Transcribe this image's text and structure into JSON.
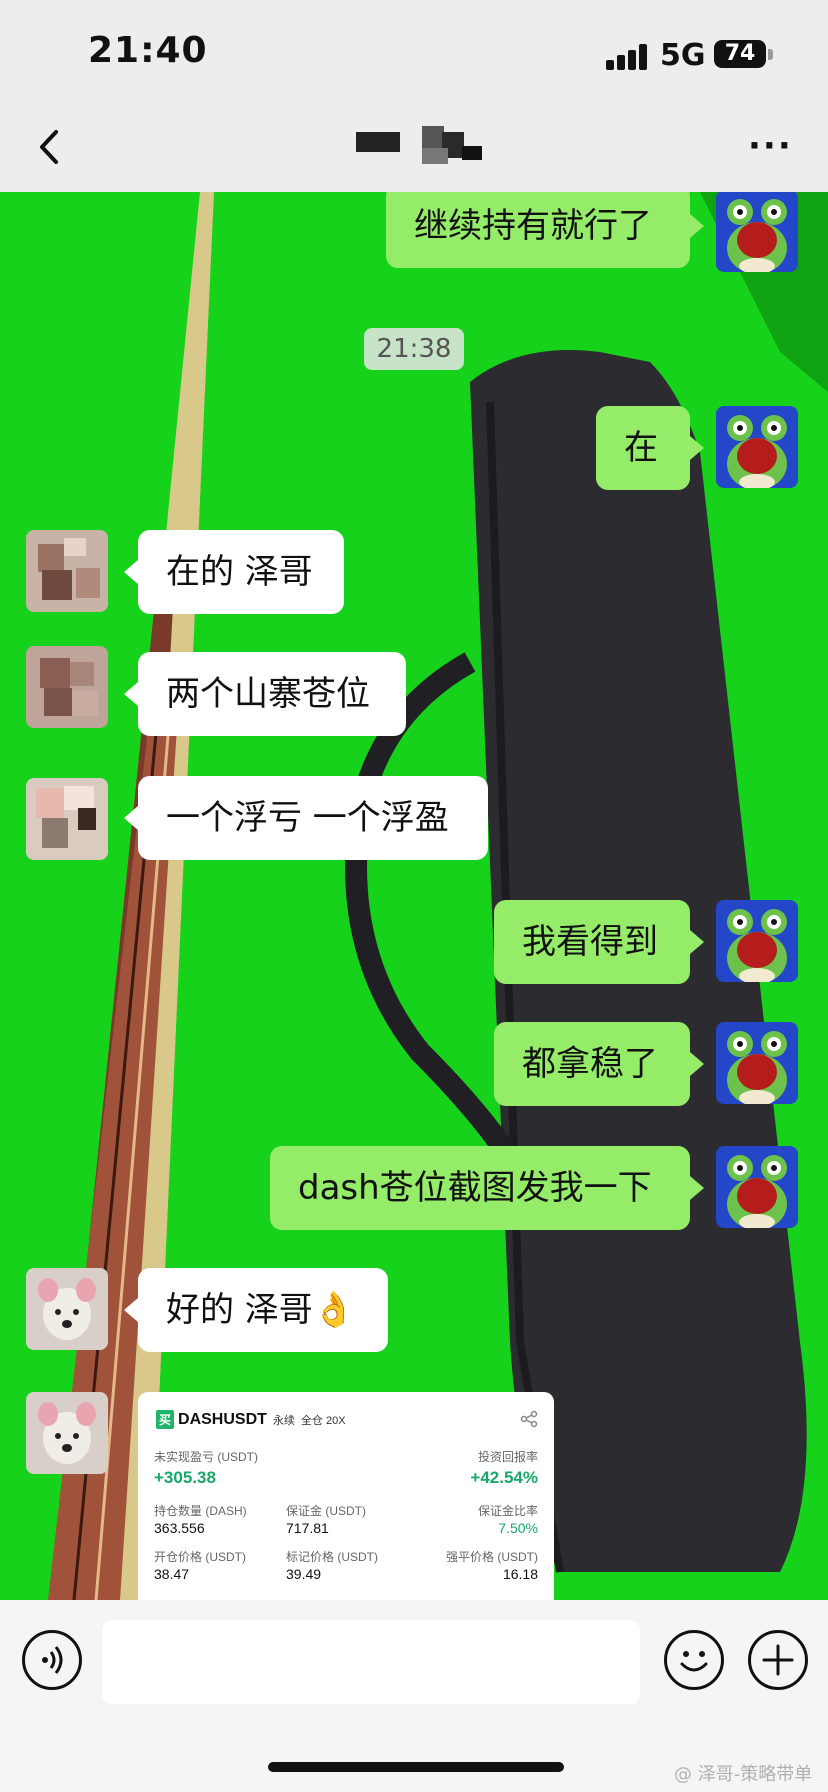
{
  "status": {
    "time": "21:40",
    "network": "5G",
    "battery": "74"
  },
  "nav": {
    "back_icon": "chevron-left-icon",
    "more_label": "···"
  },
  "messages": {
    "m1": "继续持有就行了",
    "time_divider": "21:38",
    "m2": "在",
    "m3": "在的 泽哥",
    "m4": "两个山寨苍位",
    "m5": "一个浮亏 一个浮盈",
    "m6": "我看得到",
    "m7": "都拿稳了",
    "m8": "dash苍位截图发我一下",
    "m9": "好的 泽哥👌"
  },
  "card": {
    "buy_tag": "买",
    "symbol": "DASHUSDT",
    "perp": "永续",
    "mode": "全仓 20X",
    "unrealized_label": "未实现盈亏 (USDT)",
    "unrealized_value": "+305.38",
    "roi_label": "投资回报率",
    "roi_value": "+42.54%",
    "qty_label": "持仓数量 (DASH)",
    "qty_value": "363.556",
    "margin_label": "保证金 (USDT)",
    "margin_value": "717.81",
    "margin_ratio_label": "保证金比率",
    "margin_ratio_value": "7.50%",
    "entry_label": "开仓价格 (USDT)",
    "entry_value": "38.47",
    "mark_label": "标记价格 (USDT)",
    "mark_value": "39.49",
    "liq_label": "强平价格 (USDT)",
    "liq_value": "16.18"
  },
  "input": {
    "placeholder": ""
  },
  "watermark": "@ 泽哥-策略带单"
}
